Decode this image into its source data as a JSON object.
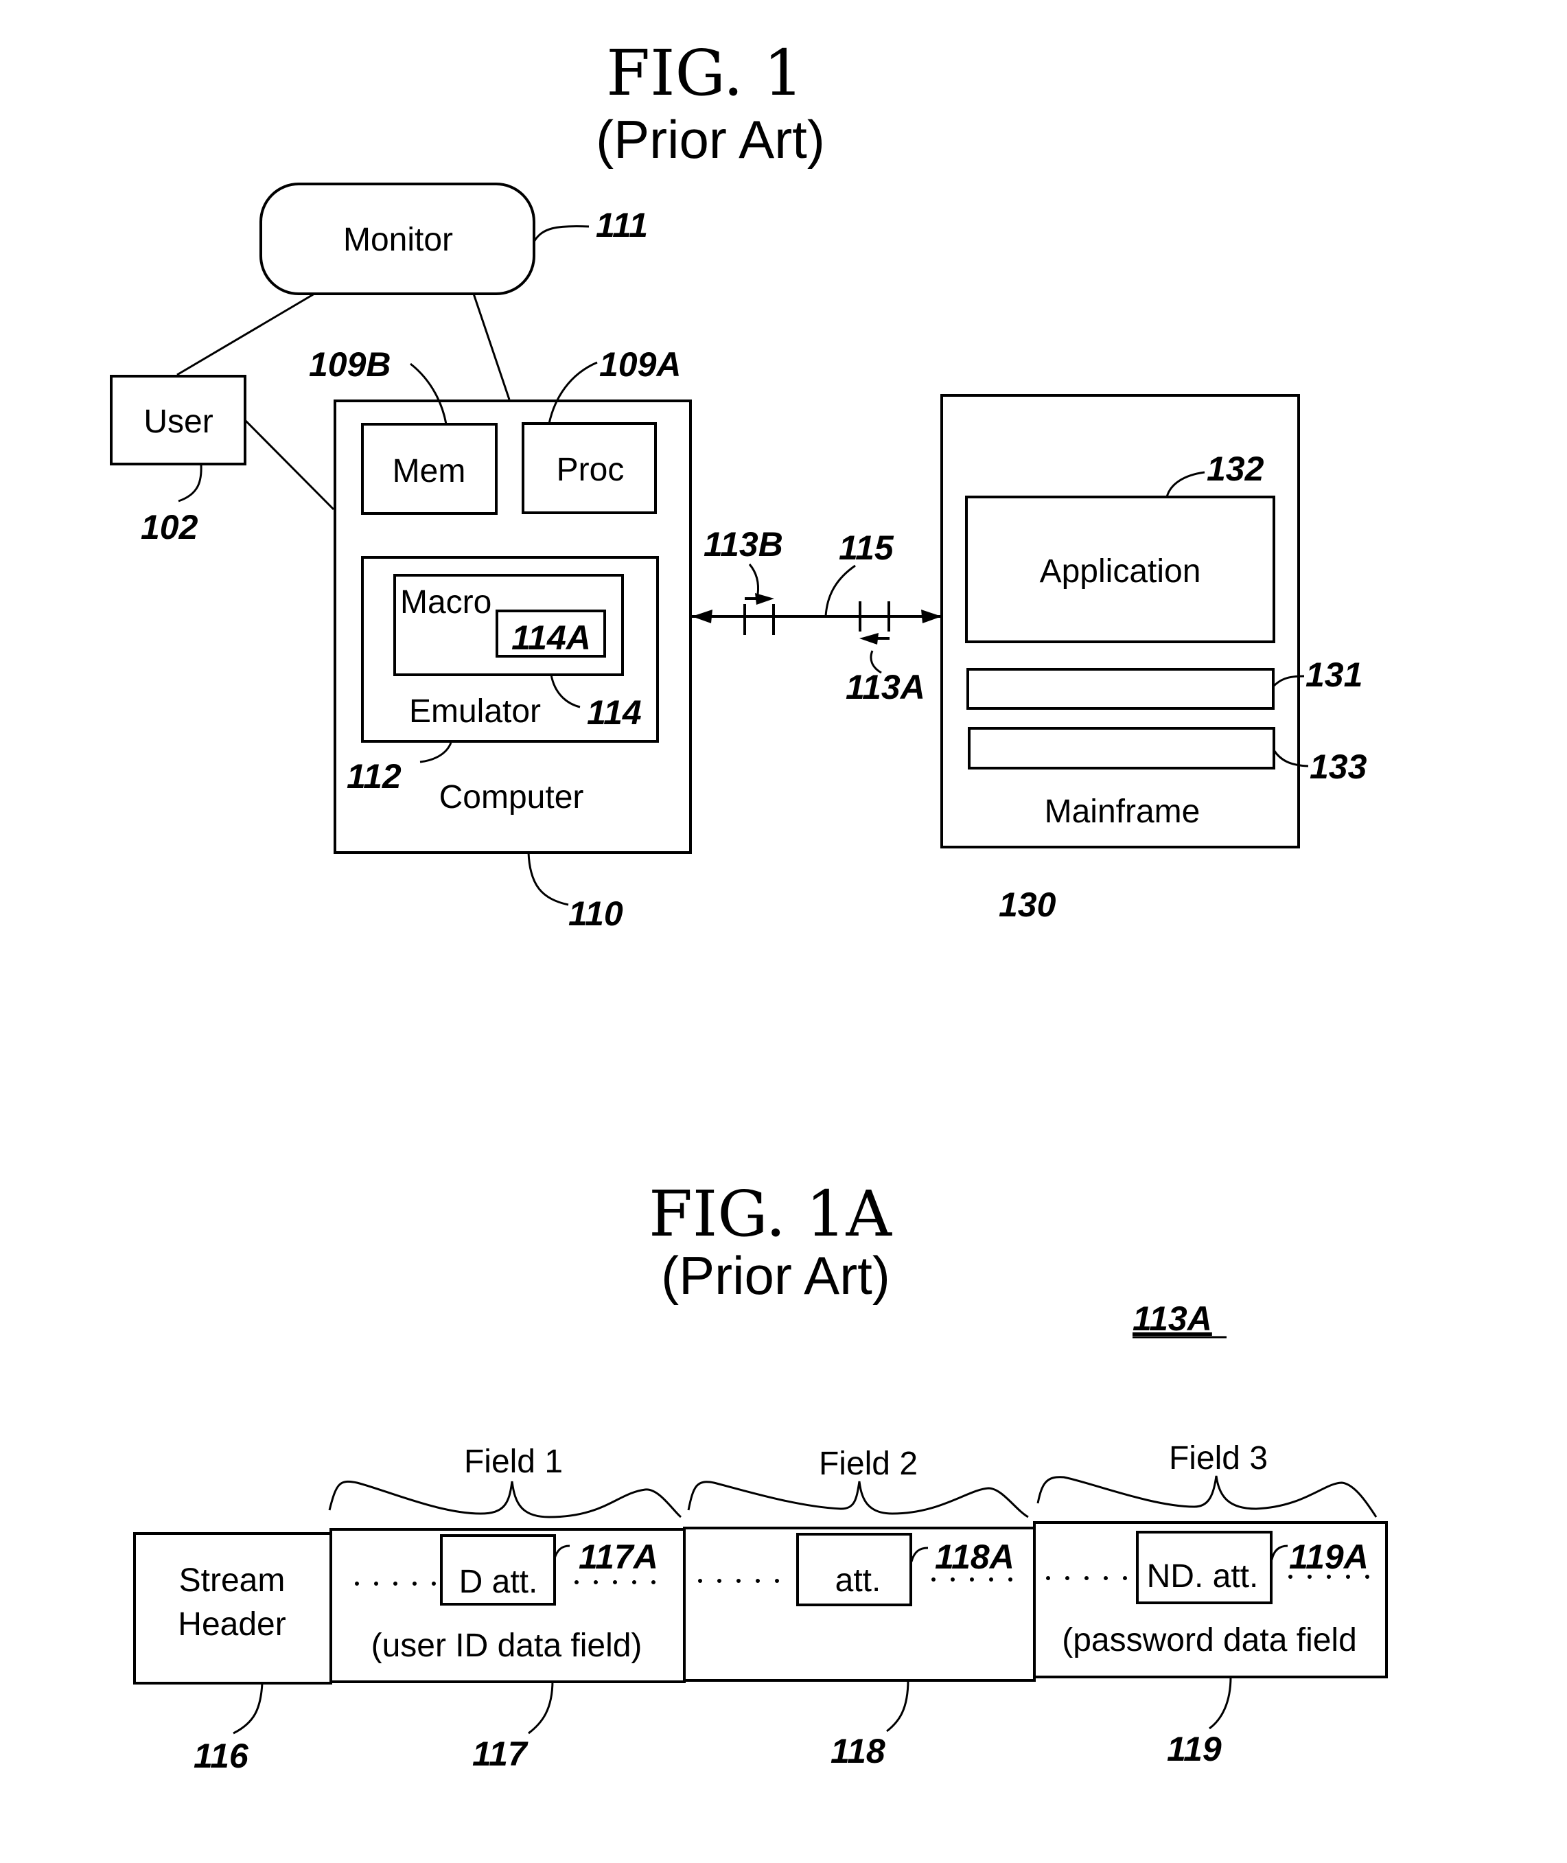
{
  "fig1": {
    "title": "FIG. 1",
    "subtitle": "(Prior Art)",
    "nodes": {
      "monitor": {
        "label": "Monitor",
        "ref": "111"
      },
      "user": {
        "label": "User",
        "ref": "102"
      },
      "computer": {
        "label": "Computer",
        "ref": "110"
      },
      "memory": {
        "label": "Mem",
        "ref": "109B"
      },
      "processor": {
        "label": "Proc",
        "ref": "109A"
      },
      "emulator": {
        "label": "Emulator",
        "ref": "112"
      },
      "macro": {
        "label": "Macro",
        "ref": "114"
      },
      "macro_item": {
        "label": "114A"
      },
      "mainframe": {
        "label": "Mainframe",
        "ref": "130"
      },
      "application": {
        "label": "Application",
        "ref": "132"
      },
      "field_131": {
        "ref": "131"
      },
      "field_133": {
        "ref": "133"
      }
    },
    "connection": {
      "link_ref": "115",
      "outbound_ref": "113B",
      "inbound_ref": "113A"
    }
  },
  "fig1a": {
    "title": "FIG. 1A",
    "subtitle": "(Prior Art)",
    "stream_ref": "113A",
    "header": {
      "line1": "Stream",
      "line2": "Header",
      "ref": "116"
    },
    "fields": [
      {
        "brace_label": "Field 1",
        "attr_label": "D att.",
        "attr_ref": "117A",
        "caption": "(user ID data field)",
        "ref": "117"
      },
      {
        "brace_label": "Field 2",
        "attr_label": "att.",
        "attr_ref": "118A",
        "caption": "",
        "ref": "118"
      },
      {
        "brace_label": "Field 3",
        "attr_label": "ND. att.",
        "attr_ref": "119A",
        "caption": "(password data field",
        "ref": "119"
      }
    ]
  }
}
